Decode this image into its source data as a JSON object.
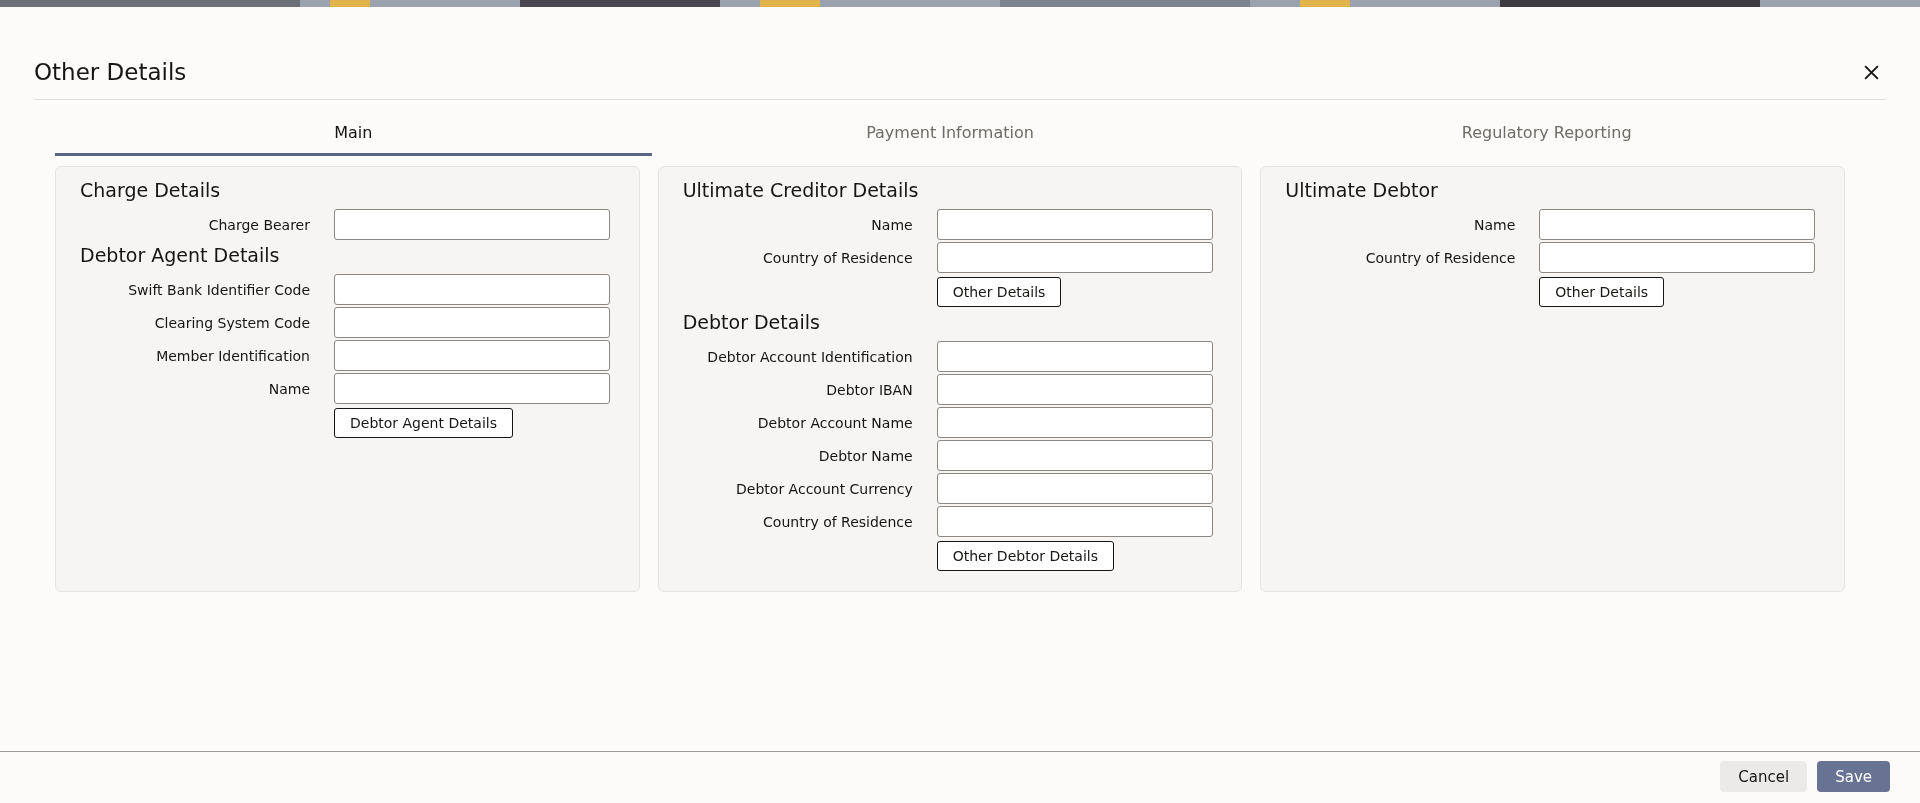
{
  "title": "Other Details",
  "tabs": [
    {
      "label": "Main",
      "selected": true
    },
    {
      "label": "Payment Information",
      "selected": false
    },
    {
      "label": "Regulatory Reporting",
      "selected": false
    }
  ],
  "panels": [
    {
      "sections": [
        {
          "heading": "Charge Details",
          "fields": [
            "Charge Bearer"
          ]
        },
        {
          "heading": "Debtor Agent Details",
          "fields": [
            "Swift Bank Identifier Code",
            "Clearing System Code",
            "Member Identification",
            "Name"
          ],
          "button": "Debtor Agent Details"
        }
      ]
    },
    {
      "sections": [
        {
          "heading": "Ultimate Creditor Details",
          "fields": [
            "Name",
            "Country of Residence"
          ],
          "button": "Other Details"
        },
        {
          "heading": "Debtor Details",
          "fields": [
            "Debtor Account Identification",
            "Debtor IBAN",
            "Debtor Account Name",
            "Debtor Name",
            "Debtor Account Currency",
            "Country of Residence"
          ],
          "button": "Other Debtor Details"
        }
      ]
    },
    {
      "sections": [
        {
          "heading": "Ultimate Debtor",
          "fields": [
            "Name",
            "Country of Residence"
          ],
          "button": "Other Details"
        }
      ]
    }
  ],
  "footer": {
    "buttons": [
      {
        "label": "Cancel",
        "kind": "secondary"
      },
      {
        "label": "Save",
        "kind": "primary"
      }
    ]
  }
}
